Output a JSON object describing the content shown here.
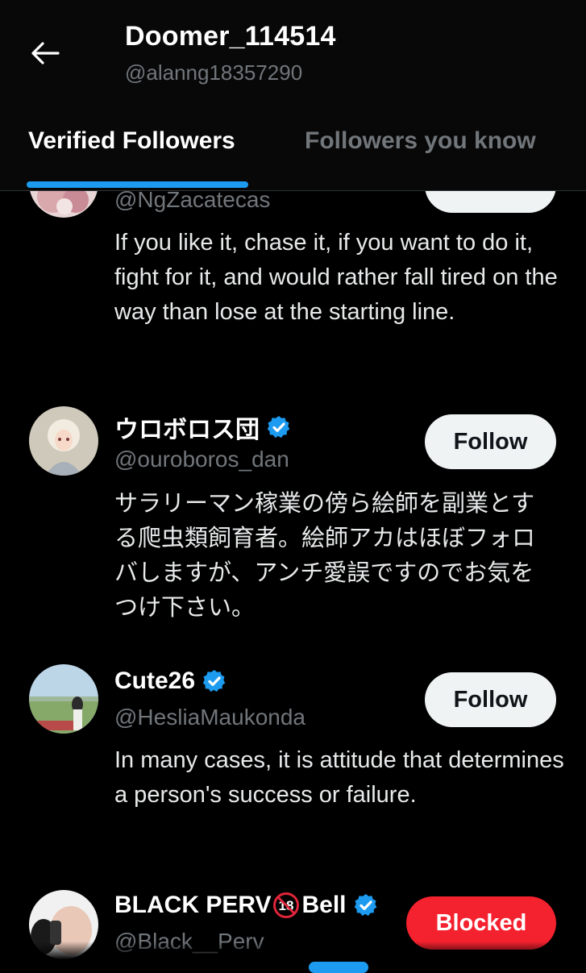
{
  "header": {
    "display_name": "Doomer_114514",
    "handle": "@alanng18357290",
    "tabs": [
      {
        "label": "Verified Followers",
        "active": true
      },
      {
        "label": "Followers you know",
        "active": false
      }
    ]
  },
  "accent_color": "#1d9bf0",
  "users": [
    {
      "handle": "@NgZacatecas",
      "bio": "If you like it, chase it, if you want to do it, fight for it, and would rather fall tired on the way than lose at the starting line."
    },
    {
      "name": "ウロボロス団",
      "handle": "@ouroboros_dan",
      "verified": true,
      "button": "Follow",
      "bio": "サラリーマン稼業の傍ら絵師を副業とする爬虫類飼育者。絵師アカはほぼフォロバしますが、アンチ愛誤ですのでお気をつけ下さい。"
    },
    {
      "name": "Cute26",
      "handle": "@HesliaMaukonda",
      "verified": true,
      "button": "Follow",
      "bio": "In many cases, it is attitude that determines a person's success or failure."
    },
    {
      "name_part1": "BLACK PERV",
      "name_icon": "no-under-18-icon",
      "name_part2": "Bell",
      "handle": "@Black__Perv",
      "verified": true,
      "button": "Blocked"
    }
  ]
}
